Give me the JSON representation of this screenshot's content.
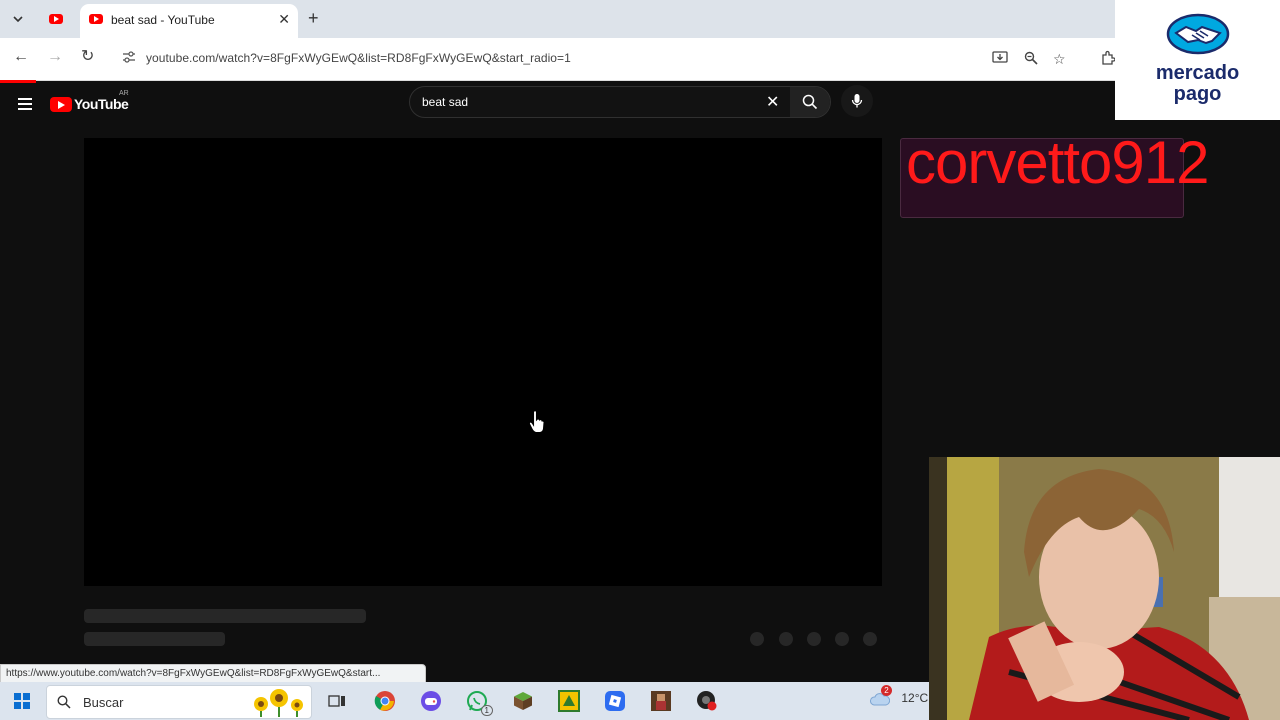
{
  "browser": {
    "tab_title": "beat sad - YouTube",
    "url": "youtube.com/watch?v=8FgFxWyGEwQ&list=RD8FgFxWyGEwQ&start_radio=1"
  },
  "youtube": {
    "logo_text": "YouTube",
    "region_code": "AR",
    "search_query": "beat sad"
  },
  "status_bar": {
    "link": "https://www.youtube.com/watch?v=8FgFxWyGEwQ&list=RD8FgFxWyGEwQ&start..."
  },
  "taskbar": {
    "search_placeholder": "Buscar",
    "weather_temp": "12°C",
    "whatsapp_badge": "1",
    "weather_badge": "2"
  },
  "overlays": {
    "brand_logo_text_line1": "mercado",
    "brand_logo_text_line2": "pago",
    "streamer_name": "corvetto912"
  },
  "colors": {
    "youtube_red": "#ff0000",
    "overlay_name_color": "#ff1a1a",
    "mercadopago_navy": "#1b2b6b",
    "mercadopago_cyan": "#00a8e1"
  }
}
